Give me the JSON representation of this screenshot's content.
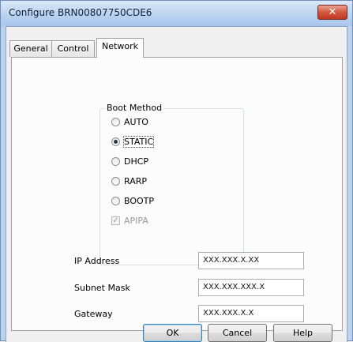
{
  "window": {
    "title": "Configure BRN00807750CDE6",
    "close_glyph": "✕"
  },
  "tabs": [
    {
      "label": "General",
      "active": false
    },
    {
      "label": "Control",
      "active": false
    },
    {
      "label": "Network",
      "active": true
    }
  ],
  "boot_method": {
    "label": "Boot Method",
    "options": [
      {
        "label": "AUTO",
        "selected": false
      },
      {
        "label": "STATIC",
        "selected": true
      },
      {
        "label": "DHCP",
        "selected": false
      },
      {
        "label": "RARP",
        "selected": false
      },
      {
        "label": "BOOTP",
        "selected": false
      }
    ],
    "apipa": {
      "label": "APIPA",
      "checked": true,
      "enabled": false,
      "check_glyph": "✓"
    }
  },
  "fields": [
    {
      "label": "IP Address",
      "value": "XXX.XXX.X.XX"
    },
    {
      "label": "Subnet Mask",
      "value": "XXX.XXX.XXX.X"
    },
    {
      "label": "Gateway",
      "value": "XXX.XXX.X.X"
    }
  ],
  "buttons": {
    "ok": "OK",
    "cancel": "Cancel",
    "help": "Help"
  }
}
